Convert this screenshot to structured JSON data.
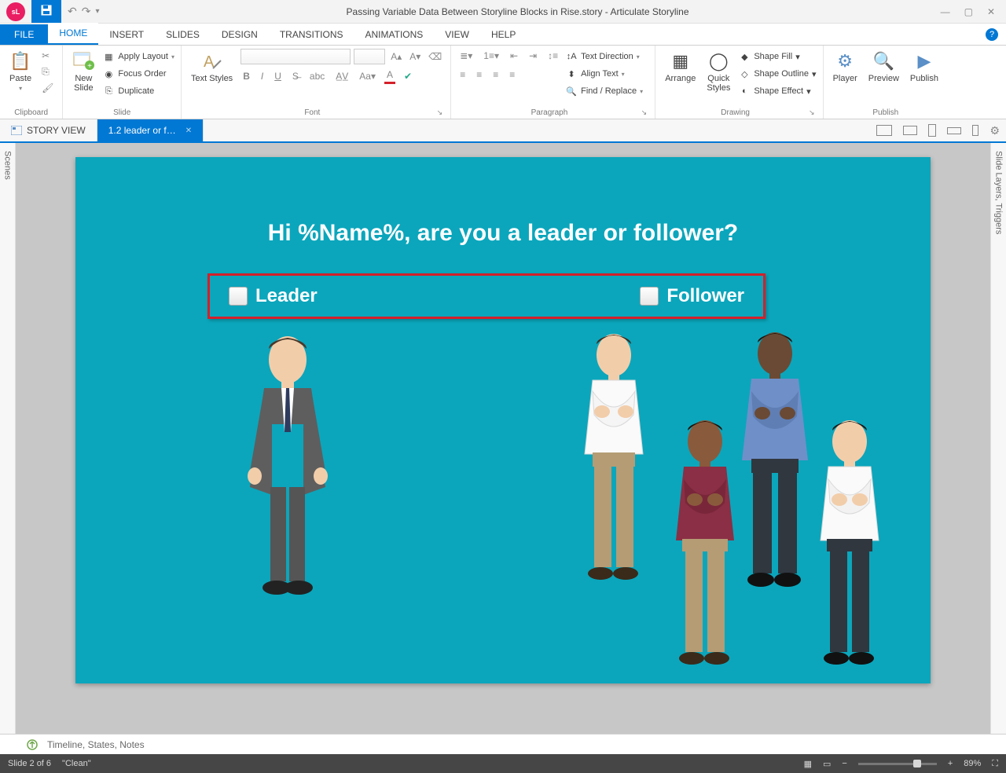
{
  "window": {
    "title": "Passing Variable Data Between Storyline Blocks in Rise.story  -  Articulate Storyline",
    "app_badge": "sL"
  },
  "tabs": {
    "file": "FILE",
    "items": [
      "HOME",
      "INSERT",
      "SLIDES",
      "DESIGN",
      "TRANSITIONS",
      "ANIMATIONS",
      "VIEW",
      "HELP"
    ],
    "active_index": 0
  },
  "ribbon": {
    "clipboard": {
      "label": "Clipboard",
      "paste": "Paste",
      "cut": "Cut",
      "copy": "Copy",
      "format_painter": "Format Painter"
    },
    "slide": {
      "label": "Slide",
      "new_slide": "New\nSlide",
      "apply_layout": "Apply Layout",
      "focus_order": "Focus Order",
      "duplicate": "Duplicate"
    },
    "font": {
      "label": "Font",
      "text_styles": "Text Styles"
    },
    "paragraph": {
      "label": "Paragraph",
      "text_direction": "Text Direction",
      "align_text": "Align Text",
      "find_replace": "Find / Replace"
    },
    "drawing": {
      "label": "Drawing",
      "arrange": "Arrange",
      "quick_styles": "Quick\nStyles",
      "shape_fill": "Shape Fill",
      "shape_outline": "Shape Outline",
      "shape_effect": "Shape Effect"
    },
    "publish": {
      "label": "Publish",
      "player": "Player",
      "preview": "Preview",
      "publish": "Publish"
    }
  },
  "sectabs": {
    "story_view": "STORY VIEW",
    "active": "1.2 leader or f…"
  },
  "side": {
    "left": "Scenes",
    "right": "Slide Layers, Triggers"
  },
  "slide": {
    "heading": "Hi %Name%, are you a leader or follower?",
    "opt1": "Leader",
    "opt2": "Follower"
  },
  "bottom": {
    "label": "Timeline, States, Notes"
  },
  "status": {
    "slide_pos": "Slide 2 of 6",
    "layout": "\"Clean\"",
    "zoom": "89%"
  }
}
